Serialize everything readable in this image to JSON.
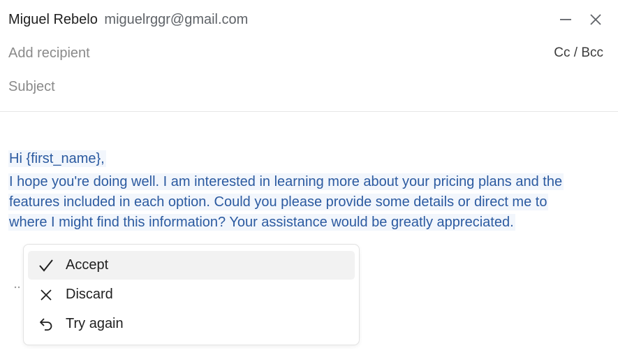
{
  "header": {
    "from_name": "Miguel Rebelo",
    "from_email": "miguelrggr@gmail.com",
    "recipient_placeholder": "Add recipient",
    "subject_placeholder": "Subject",
    "cc_bcc_label": "Cc / Bcc"
  },
  "window_controls": {
    "minimize_icon": "minimize-icon",
    "close_icon": "close-icon"
  },
  "body": {
    "greeting": "Hi {first_name},",
    "lines": [
      "I hope you're doing well. I am interested in learning more about your pricing plans and the",
      "features included in each option. Could you please provide some details or direct me to",
      "where I might find this information? Your assistance would be greatly appreciated."
    ]
  },
  "suggestion_menu": {
    "items": [
      {
        "label": "Accept",
        "icon": "check-icon"
      },
      {
        "label": "Discard",
        "icon": "x-icon"
      },
      {
        "label": "Try again",
        "icon": "undo-arrow-icon"
      }
    ]
  },
  "colors": {
    "generated_text": "#2b5aa0",
    "generated_highlight": "#f2f6fc",
    "placeholder": "#8a8a8a",
    "menu_active_bg": "#f2f2f2"
  }
}
